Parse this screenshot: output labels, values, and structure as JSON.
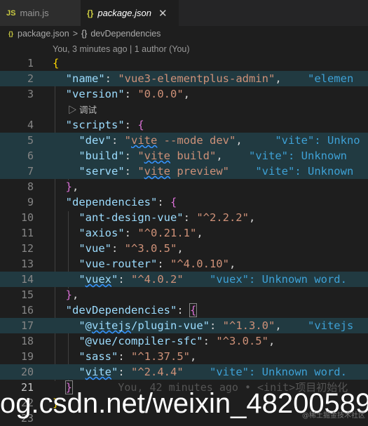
{
  "tabs": [
    {
      "icon": "JS",
      "label": "main.js",
      "active": false
    },
    {
      "icon": "{}",
      "label": "package.json",
      "active": true,
      "close": "✕"
    }
  ],
  "breadcrumb": {
    "file": "package.json",
    "separator": ">",
    "symbol_icon": "{}",
    "symbol": "devDependencies"
  },
  "codelens": "You, 3 minutes ago | 1 author (You)",
  "run_lens": "▷ 调试",
  "line_numbers": [
    "1",
    "2",
    "3",
    "4",
    "5",
    "6",
    "7",
    "8",
    "9",
    "10",
    "11",
    "12",
    "13",
    "14",
    "15",
    "16",
    "17",
    "18",
    "19",
    "20",
    "21",
    "22",
    "23"
  ],
  "code": {
    "name_key": "\"name\"",
    "name_val": "\"vue3-elementplus-admin\"",
    "name_ann": "\"elemen",
    "version_key": "\"version\"",
    "version_val": "\"0.0.0\"",
    "scripts_key": "\"scripts\"",
    "dev_key": "\"dev\"",
    "dev_val_pre": "\"",
    "dev_val_word": "vite",
    "dev_val_post": " --mode dev\"",
    "dev_ann": "\"vite\": Unkno",
    "build_key": "\"build\"",
    "build_val_pre": "\"",
    "build_val_word": "vite",
    "build_val_post": " build\"",
    "build_ann": "\"vite\": Unknown",
    "serve_key": "\"serve\"",
    "serve_val_pre": "\"",
    "serve_val_word": "vite",
    "serve_val_post": " preview\"",
    "serve_ann": "\"vite\": Unknown",
    "deps_key": "\"dependencies\"",
    "antd_key": "\"ant-design-vue\"",
    "antd_val": "\"^2.2.2\"",
    "axios_key": "\"axios\"",
    "axios_val": "\"^0.21.1\"",
    "vue_key": "\"vue\"",
    "vue_val": "\"^3.0.5\"",
    "router_key": "\"vue-router\"",
    "router_val": "\"^4.0.10\"",
    "vuex_key_pre": "\"",
    "vuex_key_word": "vuex",
    "vuex_key_post": "\"",
    "vuex_val": "\"^4.0.2\"",
    "vuex_ann": "\"vuex\": Unknown word.",
    "devdeps_key": "\"devDependencies\"",
    "pv_key_pre": "\"@",
    "pv_key_word": "vitejs",
    "pv_key_post": "/plugin-vue\"",
    "pv_val": "\"^1.3.0\"",
    "pv_ann": "\"vitejs",
    "sfc_key": "\"@vue/compiler-sfc\"",
    "sfc_val": "\"^3.0.5\"",
    "sass_key": "\"sass\"",
    "sass_val": "\"^1.37.5\"",
    "vite_key_pre": "\"",
    "vite_key_word": "vite",
    "vite_key_post": "\"",
    "vite_val": "\"^2.4.4\"",
    "vite_ann": "\"vite\": Unknown word.",
    "blame": "You, 42 minutes ago • <init>项目初始化"
  },
  "watermark": {
    "text": "og.csdn.net/weixin_48200589",
    "small": "@稀土掘金技术社区"
  },
  "colors": {
    "editor_bg": "#1e1e1e",
    "key": "#9cdcfe",
    "string": "#ce9178",
    "bracket_yellow": "#ffd700",
    "bracket_purple": "#da70d6",
    "spell_annotation": "#3ea1d6",
    "highlight_line": "#213a41"
  }
}
